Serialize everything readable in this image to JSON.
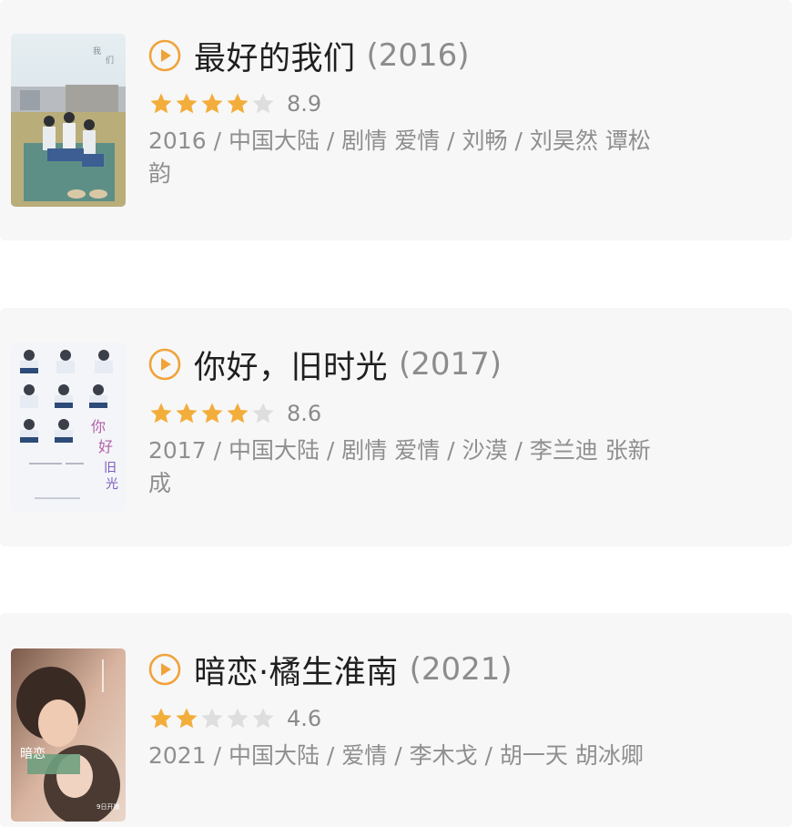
{
  "colors": {
    "card_bg": "#f7f7f7",
    "accent_orange": "#f0a33a",
    "star_filled": "#f3ad3b",
    "star_empty": "#dedede",
    "title_text": "#1f1f1f",
    "meta_text": "#8f8f8f"
  },
  "icons": {
    "play": "play-circle-icon",
    "star": "star-icon"
  },
  "movies": [
    {
      "title": "最好的我们",
      "year": "(2016)",
      "score": "8.9",
      "stars_filled": 4,
      "stars_total": 5,
      "meta": "2016 / 中国大陆 / 剧情 爱情 / 刘畅 / 刘昊然 谭松韵"
    },
    {
      "title": "你好，旧时光",
      "year": "(2017)",
      "score": "8.6",
      "stars_filled": 4,
      "stars_total": 5,
      "meta": "2017 / 中国大陆 / 剧情 爱情 / 沙漠 / 李兰迪 张新成"
    },
    {
      "title": "暗恋·橘生淮南",
      "year": "(2021)",
      "score": "4.6",
      "stars_filled": 2,
      "stars_total": 5,
      "meta": "2021 / 中国大陆 / 爱情 / 李木戈 / 胡一天 胡冰卿"
    }
  ]
}
